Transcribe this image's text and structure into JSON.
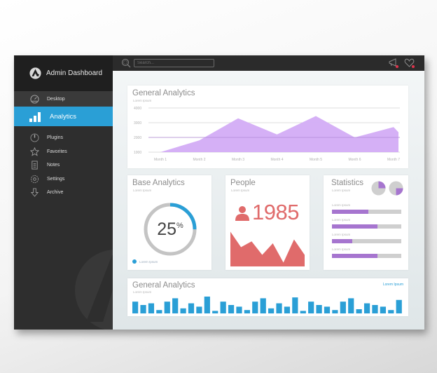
{
  "sidebar": {
    "title": "Admin Dashboard",
    "logo_icon": "brand-logo-icon",
    "items": [
      {
        "label": "Desktop",
        "icon": "speedometer-icon",
        "active": false
      },
      {
        "label": "Analytics",
        "icon": "bar-chart-icon",
        "active": true
      },
      {
        "label": "Plugins",
        "icon": "power-icon",
        "active": false
      },
      {
        "label": "Favorites",
        "icon": "star-icon",
        "active": false
      },
      {
        "label": "Notes",
        "icon": "notes-icon",
        "active": false
      },
      {
        "label": "Settings",
        "icon": "gear-icon",
        "active": false
      },
      {
        "label": "Archive",
        "icon": "arrow-down-icon",
        "active": false
      }
    ]
  },
  "topbar": {
    "search_placeholder": "Search...",
    "icons": [
      "megaphone-icon",
      "heart-icon"
    ],
    "notification_color": "#e0334c"
  },
  "colors": {
    "accent": "#2a9fd6",
    "purple": "#a675cf",
    "area_fill": "#d3acf5",
    "people": "#e06b6b"
  },
  "general_analytics": {
    "title": "General Analytics",
    "subtitle": "Lorem Ipsum"
  },
  "base_analytics": {
    "title": "Base Analytics",
    "subtitle": "Lorem Ipsum",
    "value": "25",
    "unit": "%",
    "percent": 25,
    "legend": "Lorem Ipsum"
  },
  "people": {
    "title": "People",
    "subtitle": "Lorem Ipsum",
    "count": "1985",
    "trend": [
      9,
      5,
      6.5,
      3,
      6,
      1,
      7,
      3
    ]
  },
  "statistics": {
    "title": "Statistics",
    "subtitle": "Lorem Ipsum",
    "pies": [
      25,
      25
    ],
    "rows": [
      {
        "label": "Lorem Ipsum",
        "percent": 53
      },
      {
        "label": "Lorem Ipsum",
        "percent": 66
      },
      {
        "label": "Lorem Ipsum",
        "percent": 29
      },
      {
        "label": "Lorem Ipsum",
        "percent": 66
      }
    ]
  },
  "bars_panel": {
    "title": "General Analytics",
    "subtitle": "Lorem Ipsum",
    "link": "Lorem Ipsum"
  },
  "chart_data": [
    {
      "type": "area",
      "title": "General Analytics",
      "subtitle": "Lorem Ipsum",
      "categories": [
        "Month 1",
        "Month 2",
        "Month 3",
        "Month 4",
        "Month 5",
        "Month 6",
        "Month 7"
      ],
      "values": [
        1000,
        1800,
        3300,
        2200,
        3450,
        2000,
        2700
      ],
      "end_value": 2350,
      "yticks": [
        1000,
        2000,
        3000,
        4000
      ],
      "ylim": [
        1000,
        4000
      ],
      "grid": true
    },
    {
      "type": "bar",
      "title": "General Analytics",
      "subtitle": "Lorem Ipsum",
      "values": [
        7,
        5,
        6,
        2,
        7,
        9,
        3,
        6,
        4,
        10,
        1.5,
        7,
        5,
        4,
        2,
        7,
        9,
        3,
        6,
        4,
        9.5,
        1.5,
        7,
        5,
        4,
        2,
        7,
        9,
        2.5,
        6,
        5,
        4,
        2,
        8
      ],
      "ylim": [
        0,
        10
      ],
      "grid": false
    }
  ]
}
